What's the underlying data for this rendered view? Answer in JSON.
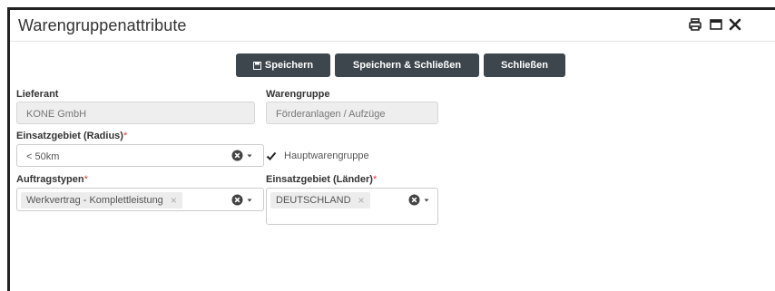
{
  "window": {
    "title": "Warengruppenattribute"
  },
  "toolbar": {
    "save_label": "Speichern",
    "save_close_label": "Speichern & Schließen",
    "close_label": "Schließen"
  },
  "form": {
    "lieferant": {
      "label": "Lieferant",
      "value": "KONE GmbH"
    },
    "warengruppe": {
      "label": "Warengruppe",
      "value": "Förderanlagen / Aufzüge"
    },
    "einsatzgebiet_radius": {
      "label": "Einsatzgebiet (Radius)",
      "required": "*",
      "value": "< 50km"
    },
    "hauptwarengruppe": {
      "label": "Hauptwarengruppe",
      "checked": true
    },
    "auftragstypen": {
      "label": "Auftragstypen",
      "required": "*",
      "tag": "Werkvertrag - Komplettleistung",
      "tag_remove": "×"
    },
    "einsatzgebiet_laender": {
      "label": "Einsatzgebiet (Länder)",
      "required": "*",
      "tag": "DEUTSCHLAND",
      "tag_remove": "×"
    }
  },
  "icons": [
    "print-icon",
    "maximize-icon",
    "close-icon",
    "save-icon",
    "clear-icon",
    "chevron-down-icon",
    "checkmark-icon"
  ]
}
